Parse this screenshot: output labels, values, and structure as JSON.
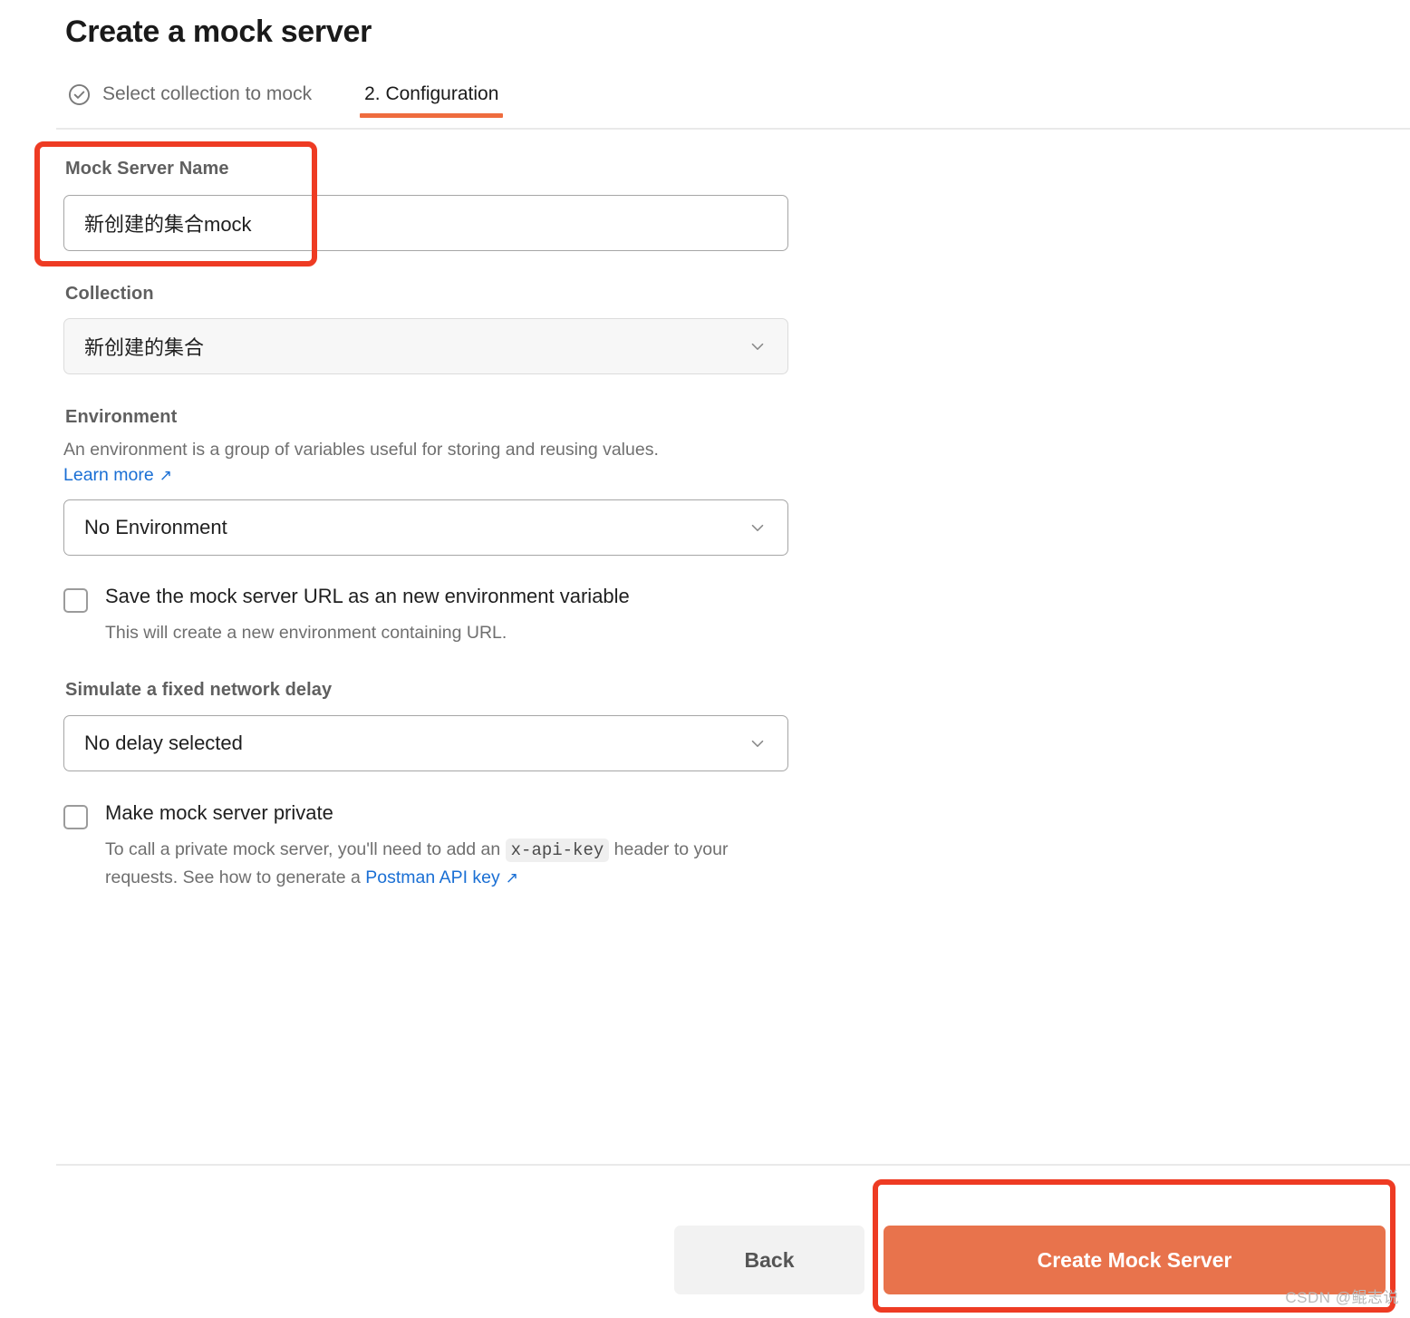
{
  "header": {
    "title": "Create a mock server",
    "tabs": [
      {
        "label": "Select collection to mock",
        "icon": "check-circle-icon",
        "state": "completed"
      },
      {
        "label": "2. Configuration",
        "state": "active"
      }
    ]
  },
  "form": {
    "mock_server_name": {
      "label": "Mock Server Name",
      "value": "新创建的集合mock",
      "placeholder": "Mock Server Name"
    },
    "collection": {
      "label": "Collection",
      "value": "新创建的集合",
      "icon": "chevron-down-icon",
      "disabled": true
    },
    "environment": {
      "label": "Environment",
      "description": "An environment is a group of variables useful for storing and reusing values.",
      "link_label": "Learn more",
      "link_arrow": "↗",
      "value": "No Environment",
      "icon": "chevron-down-icon"
    },
    "save_url_checkbox": {
      "label": "Save the mock server URL as an new environment variable",
      "sub_label": "This will create a new environment containing URL.",
      "checked": false
    },
    "network_delay": {
      "label": "Simulate a fixed network delay",
      "value": "No delay selected",
      "icon": "chevron-down-icon"
    },
    "private_checkbox": {
      "label": "Make mock server private",
      "sub_prefix": "To call a private mock server, you'll need to add an ",
      "code_chip": "x-api-key",
      "sub_middle": " header to your requests. See how to generate a ",
      "link_label": "Postman API key",
      "link_arrow": "↗",
      "checked": false
    }
  },
  "footer": {
    "back_label": "Back",
    "create_label": "Create Mock Server"
  },
  "watermark": "CSDN @鲲志说",
  "colors": {
    "accent_orange": "#E8734C",
    "tab_underline": "#EF6C3E",
    "annotation_red": "#EE3B23",
    "link_blue": "#1A6FD4"
  }
}
